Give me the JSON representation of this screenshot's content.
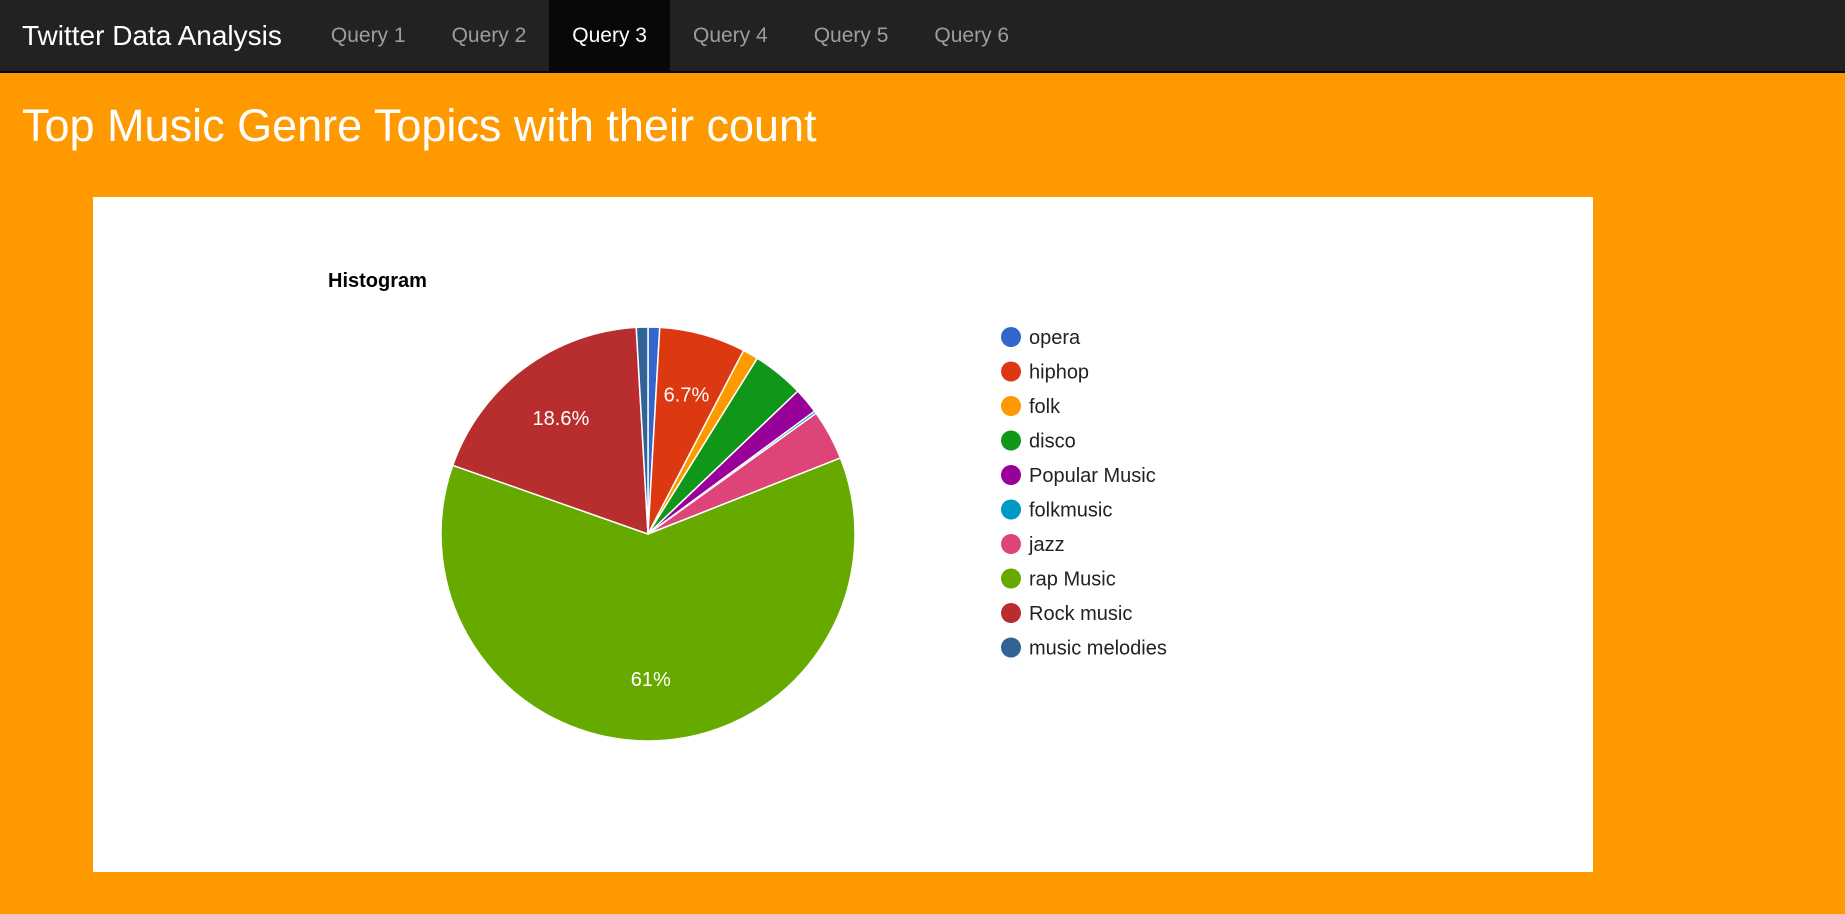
{
  "navbar": {
    "brand": "Twitter Data Analysis",
    "items": [
      {
        "label": "Query 1",
        "active": false
      },
      {
        "label": "Query 2",
        "active": false
      },
      {
        "label": "Query 3",
        "active": true
      },
      {
        "label": "Query 4",
        "active": false
      },
      {
        "label": "Query 5",
        "active": false
      },
      {
        "label": "Query 6",
        "active": false
      }
    ]
  },
  "page": {
    "title": "Top Music Genre Topics with their count"
  },
  "chart_data": {
    "type": "pie",
    "title": "Histogram",
    "legend_position": "right",
    "slices": [
      {
        "label": "opera",
        "percent": 0.9,
        "color": "#3366cc",
        "data_label": ""
      },
      {
        "label": "hiphop",
        "percent": 6.7,
        "color": "#dc3912",
        "data_label": "6.7%"
      },
      {
        "label": "folk",
        "percent": 1.2,
        "color": "#ff9900",
        "data_label": ""
      },
      {
        "label": "disco",
        "percent": 4.0,
        "color": "#109618",
        "data_label": ""
      },
      {
        "label": "Popular Music",
        "percent": 2.0,
        "color": "#990099",
        "data_label": ""
      },
      {
        "label": "folkmusic",
        "percent": 0.2,
        "color": "#0099c6",
        "data_label": ""
      },
      {
        "label": "jazz",
        "percent": 3.9,
        "color": "#dd4477",
        "data_label": ""
      },
      {
        "label": "rap Music",
        "percent": 61.0,
        "color": "#66aa00",
        "data_label": "61%"
      },
      {
        "label": "Rock music",
        "percent": 18.6,
        "color": "#b82e2e",
        "data_label": "18.6%"
      },
      {
        "label": "music melodies",
        "percent": 0.9,
        "color": "#316395",
        "data_label": ""
      }
    ]
  }
}
